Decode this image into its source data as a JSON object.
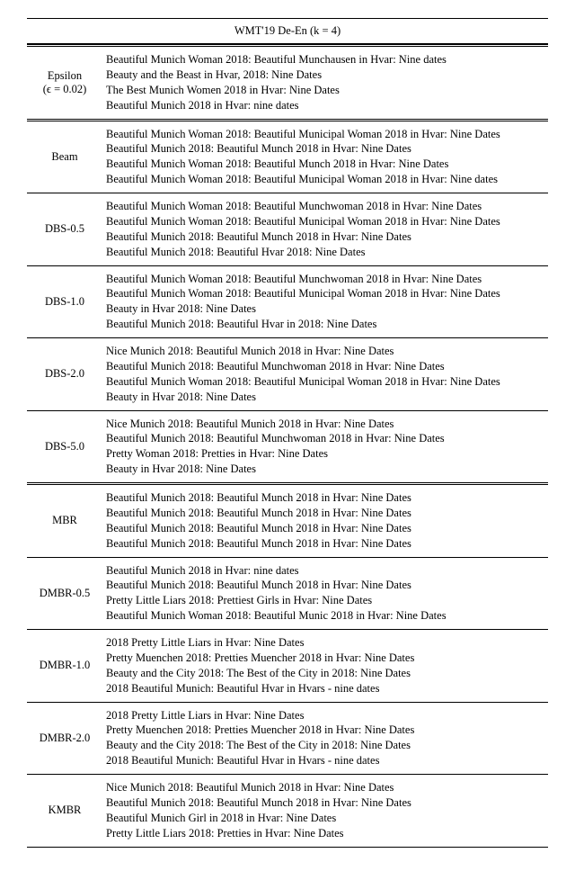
{
  "title": "WMT'19 De-En (k = 4)",
  "groups": [
    {
      "label_plain": "Epsilon",
      "label_sub": "(ϵ = 0.02)",
      "lines": [
        "Beautiful Munich Woman 2018: Beautiful Munchausen in Hvar: Nine dates",
        "Beauty and the Beast in Hvar, 2018: Nine Dates",
        "The Best Munich Women 2018 in Hvar: Nine Dates",
        "Beautiful Munich 2018 in Hvar: nine dates"
      ],
      "sep_after": "double"
    },
    {
      "label_plain": "Beam",
      "lines": [
        "Beautiful Munich Woman 2018: Beautiful Municipal Woman 2018 in Hvar: Nine Dates",
        "Beautiful Munich 2018: Beautiful Munch 2018 in Hvar: Nine Dates",
        "Beautiful Munich Woman 2018: Beautiful Munch 2018 in Hvar: Nine Dates",
        "Beautiful Munich Woman 2018: Beautiful Municipal Woman 2018 in Hvar: Nine dates"
      ],
      "sep_after": "single"
    },
    {
      "label_plain": "DBS-0.5",
      "lines": [
        "Beautiful Munich Woman 2018: Beautiful Munchwoman 2018 in Hvar: Nine Dates",
        "Beautiful Munich Woman 2018: Beautiful Municipal Woman 2018 in Hvar: Nine Dates",
        "Beautiful Munich 2018: Beautiful Munch 2018 in Hvar: Nine Dates",
        "Beautiful Munich 2018: Beautiful Hvar 2018: Nine Dates"
      ],
      "sep_after": "single"
    },
    {
      "label_plain": "DBS-1.0",
      "lines": [
        "Beautiful Munich Woman 2018: Beautiful Munchwoman 2018 in Hvar: Nine Dates",
        "Beautiful Munich Woman 2018: Beautiful Municipal Woman 2018 in Hvar: Nine Dates",
        "Beauty in Hvar 2018: Nine Dates",
        "Beautiful Munich 2018: Beautiful Hvar in 2018: Nine Dates"
      ],
      "sep_after": "single"
    },
    {
      "label_plain": "DBS-2.0",
      "lines": [
        "Nice Munich 2018: Beautiful Munich 2018 in Hvar: Nine Dates",
        "Beautiful Munich 2018: Beautiful Munchwoman 2018 in Hvar: Nine Dates",
        "Beautiful Munich Woman 2018: Beautiful Municipal Woman 2018 in Hvar: Nine Dates",
        "Beauty in Hvar 2018: Nine Dates"
      ],
      "sep_after": "single"
    },
    {
      "label_plain": "DBS-5.0",
      "lines": [
        "Nice Munich 2018: Beautiful Munich 2018 in Hvar: Nine Dates",
        "Beautiful Munich 2018: Beautiful Munchwoman 2018 in Hvar: Nine Dates",
        "Pretty Woman 2018: Pretties in Hvar: Nine Dates",
        "Beauty in Hvar 2018: Nine Dates"
      ],
      "sep_after": "double"
    },
    {
      "label_plain": "MBR",
      "lines": [
        "Beautiful Munich 2018: Beautiful Munch 2018 in Hvar: Nine Dates",
        "Beautiful Munich 2018: Beautiful Munch 2018 in Hvar: Nine Dates",
        "Beautiful Munich 2018: Beautiful Munch 2018 in Hvar: Nine Dates",
        "Beautiful Munich 2018: Beautiful Munch 2018 in Hvar: Nine Dates"
      ],
      "sep_after": "single"
    },
    {
      "label_plain": "DMBR-0.5",
      "lines": [
        "Beautiful Munich 2018 in Hvar: nine dates",
        "Beautiful Munich 2018: Beautiful Munch 2018 in Hvar: Nine Dates",
        "Pretty Little Liars 2018: Prettiest Girls in Hvar: Nine Dates",
        "Beautiful Munich Woman 2018: Beautiful Munic 2018 in Hvar: Nine Dates"
      ],
      "sep_after": "single"
    },
    {
      "label_plain": "DMBR-1.0",
      "lines": [
        "2018 Pretty Little Liars in Hvar: Nine Dates",
        "Pretty Muenchen 2018: Pretties Muencher 2018 in Hvar: Nine Dates",
        "Beauty and the City 2018: The Best of the City in 2018: Nine Dates",
        "2018 Beautiful Munich: Beautiful Hvar in Hvars - nine dates"
      ],
      "sep_after": "single"
    },
    {
      "label_plain": "DMBR-2.0",
      "lines": [
        "2018 Pretty Little Liars in Hvar: Nine Dates",
        "Pretty Muenchen 2018: Pretties Muencher 2018 in Hvar: Nine Dates",
        "Beauty and the City 2018: The Best of the City in 2018: Nine Dates",
        "2018 Beautiful Munich: Beautiful Hvar in Hvars - nine dates"
      ],
      "sep_after": "single"
    },
    {
      "label_plain": "KMBR",
      "lines": [
        "Nice Munich 2018: Beautiful Munich 2018 in Hvar: Nine Dates",
        "Beautiful Munich 2018: Beautiful Munch 2018 in Hvar: Nine Dates",
        "Beautiful Munich Girl in 2018 in Hvar: Nine Dates",
        "Pretty Little Liars 2018: Pretties in Hvar: Nine Dates"
      ],
      "sep_after": "single"
    }
  ]
}
